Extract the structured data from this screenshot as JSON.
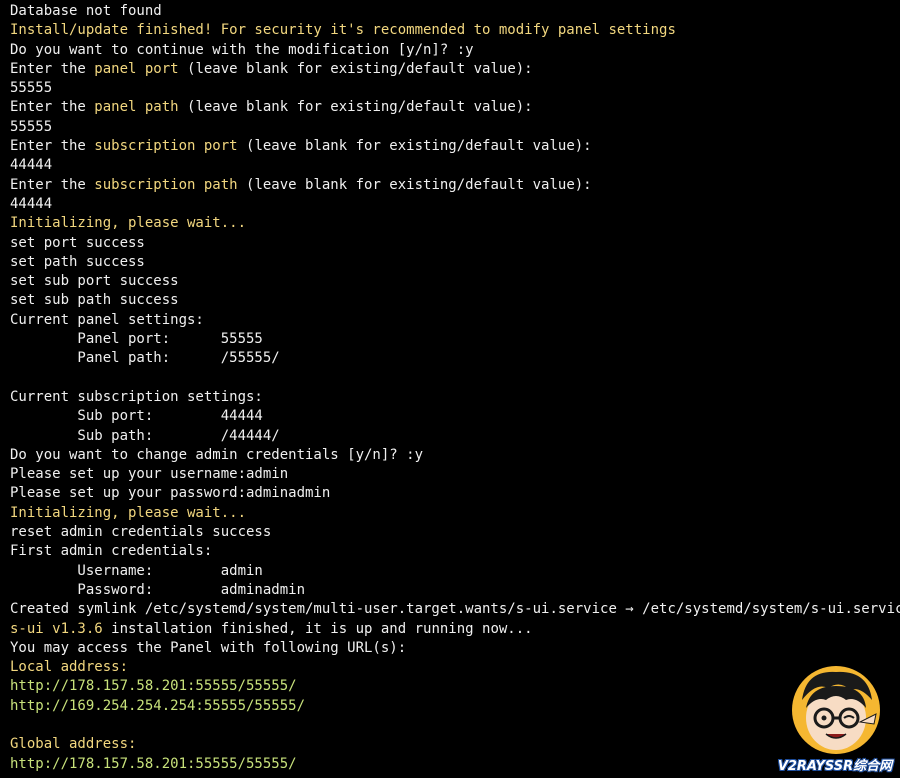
{
  "terminal": {
    "lines": [
      [
        {
          "t": "Database not found",
          "c": "w"
        }
      ],
      [
        {
          "t": "Install/update finished! For security it's recommended to modify panel settings",
          "c": "y"
        }
      ],
      [
        {
          "t": "Do you want to continue with the modification [y/n]? :y",
          "c": "w"
        }
      ],
      [
        {
          "t": "Enter the ",
          "c": "w"
        },
        {
          "t": "panel port",
          "c": "y"
        },
        {
          "t": " (leave blank for existing/default value):",
          "c": "w"
        }
      ],
      [
        {
          "t": "55555",
          "c": "w"
        }
      ],
      [
        {
          "t": "Enter the ",
          "c": "w"
        },
        {
          "t": "panel path",
          "c": "y"
        },
        {
          "t": " (leave blank for existing/default value):",
          "c": "w"
        }
      ],
      [
        {
          "t": "55555",
          "c": "w"
        }
      ],
      [
        {
          "t": "Enter the ",
          "c": "w"
        },
        {
          "t": "subscription port",
          "c": "y"
        },
        {
          "t": " (leave blank for existing/default value):",
          "c": "w"
        }
      ],
      [
        {
          "t": "44444",
          "c": "w"
        }
      ],
      [
        {
          "t": "Enter the ",
          "c": "w"
        },
        {
          "t": "subscription path",
          "c": "y"
        },
        {
          "t": " (leave blank for existing/default value):",
          "c": "w"
        }
      ],
      [
        {
          "t": "44444",
          "c": "w"
        }
      ],
      [
        {
          "t": "Initializing, please wait...",
          "c": "y"
        }
      ],
      [
        {
          "t": "set port success",
          "c": "w"
        }
      ],
      [
        {
          "t": "set path success",
          "c": "w"
        }
      ],
      [
        {
          "t": "set sub port success",
          "c": "w"
        }
      ],
      [
        {
          "t": "set sub path success",
          "c": "w"
        }
      ],
      [
        {
          "t": "Current panel settings:",
          "c": "w"
        }
      ],
      [
        {
          "t": "        Panel port:      55555",
          "c": "w"
        }
      ],
      [
        {
          "t": "        Panel path:      /55555/",
          "c": "w"
        }
      ],
      [
        {
          "t": "",
          "c": "w"
        }
      ],
      [
        {
          "t": "Current subscription settings:",
          "c": "w"
        }
      ],
      [
        {
          "t": "        Sub port:        44444",
          "c": "w"
        }
      ],
      [
        {
          "t": "        Sub path:        /44444/",
          "c": "w"
        }
      ],
      [
        {
          "t": "Do you want to change admin credentials [y/n]? :y",
          "c": "w"
        }
      ],
      [
        {
          "t": "Please set up your username:admin",
          "c": "w"
        }
      ],
      [
        {
          "t": "Please set up your password:adminadmin",
          "c": "w"
        }
      ],
      [
        {
          "t": "Initializing, please wait...",
          "c": "y"
        }
      ],
      [
        {
          "t": "reset admin credentials success",
          "c": "w"
        }
      ],
      [
        {
          "t": "First admin credentials:",
          "c": "w"
        }
      ],
      [
        {
          "t": "        Username:        admin",
          "c": "w"
        }
      ],
      [
        {
          "t": "        Password:        adminadmin",
          "c": "w"
        }
      ],
      [
        {
          "t": "Created symlink /etc/systemd/system/multi-user.target.wants/s-ui.service → /etc/systemd/system/s-ui.service.",
          "c": "w"
        }
      ],
      [
        {
          "t": "s-ui v1.3.6",
          "c": "y"
        },
        {
          "t": " installation finished, it is up and running now...",
          "c": "w"
        }
      ],
      [
        {
          "t": "You may access the Panel with following URL(s):",
          "c": "w"
        }
      ],
      [
        {
          "t": "Local address:",
          "c": "y"
        }
      ],
      [
        {
          "t": "http://178.157.58.201:55555/55555/",
          "c": "g"
        }
      ],
      [
        {
          "t": "http://169.254.254.254:55555/55555/",
          "c": "g"
        }
      ],
      [
        {
          "t": "",
          "c": "w"
        }
      ],
      [
        {
          "t": "Global address:",
          "c": "y"
        }
      ],
      [
        {
          "t": "http://178.157.58.201:55555/55555/",
          "c": "g"
        }
      ]
    ]
  },
  "watermark": {
    "text": "V2RAYSSR综合网"
  },
  "colors": {
    "background": "#000000",
    "text": "#f0f0f0",
    "highlight_yellow": "#f2d77f",
    "url_green": "#c8e27b"
  }
}
